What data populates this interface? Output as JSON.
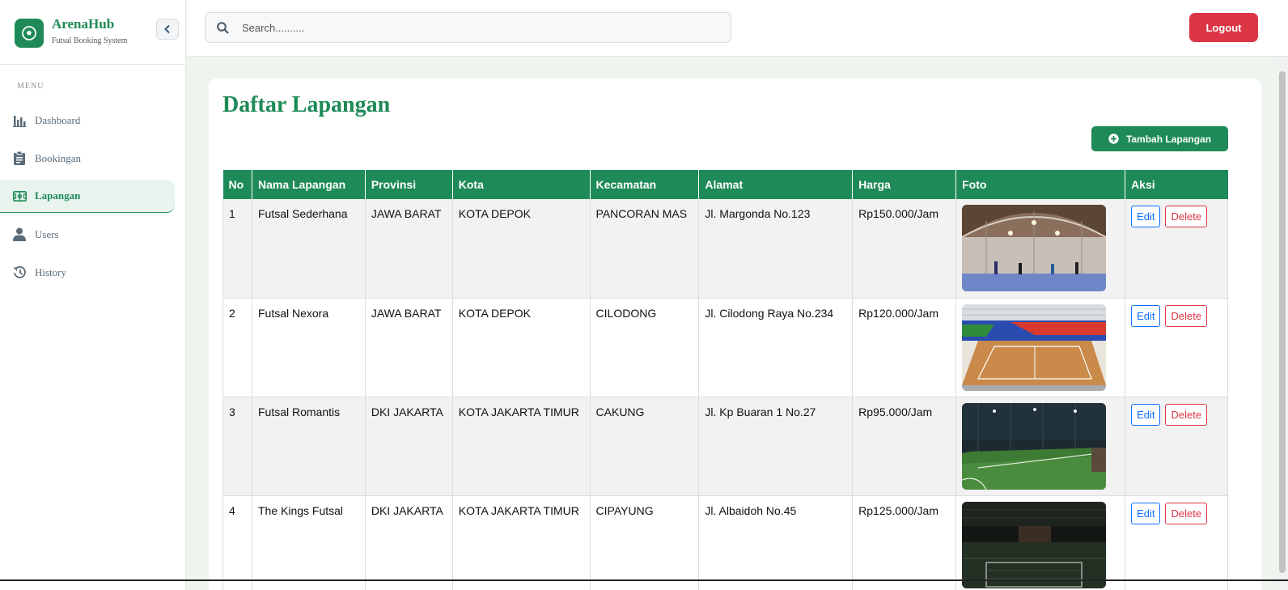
{
  "brand": {
    "name": "ArenaHub",
    "subtitle": "Futsal Booking System"
  },
  "sidebar": {
    "menu_label": "MENU",
    "items": [
      {
        "label": "Dashboard",
        "icon": "bar-chart-icon",
        "active": false
      },
      {
        "label": "Bookingan",
        "icon": "clipboard-icon",
        "active": false
      },
      {
        "label": "Lapangan",
        "icon": "field-icon",
        "active": true
      },
      {
        "label": "Users",
        "icon": "user-icon",
        "active": false
      },
      {
        "label": "History",
        "icon": "history-icon",
        "active": false
      }
    ]
  },
  "topbar": {
    "search_placeholder": "Search..........",
    "logout_label": "Logout"
  },
  "main": {
    "title": "Daftar Lapangan",
    "add_button_label": "Tambah Lapangan",
    "table": {
      "headers": [
        "No",
        "Nama Lapangan",
        "Provinsi",
        "Kota",
        "Kecamatan",
        "Alamat",
        "Harga",
        "Foto",
        "Aksi"
      ],
      "rows": [
        {
          "no": "1",
          "nama": "Futsal Sederhana",
          "provinsi": "JAWA BARAT",
          "kota": "KOTA DEPOK",
          "kecamatan": "PANCORAN MAS",
          "alamat": "Jl. Margonda No.123",
          "harga": "Rp150.000/Jam",
          "foto": "indoor-hall-photo"
        },
        {
          "no": "2",
          "nama": "Futsal Nexora",
          "provinsi": "JAWA BARAT",
          "kota": "KOTA DEPOK",
          "kecamatan": "CILODONG",
          "alamat": "Jl. Cilodong Raya No.234",
          "harga": "Rp120.000/Jam",
          "foto": "arena-photo"
        },
        {
          "no": "3",
          "nama": "Futsal Romantis",
          "provinsi": "DKI JAKARTA",
          "kota": "KOTA JAKARTA TIMUR",
          "kecamatan": "CAKUNG",
          "alamat": "Jl. Kp Buaran 1 No.27",
          "harga": "Rp95.000/Jam",
          "foto": "grass-field-photo"
        },
        {
          "no": "4",
          "nama": "The Kings Futsal",
          "provinsi": "DKI JAKARTA",
          "kota": "KOTA JAKARTA TIMUR",
          "kecamatan": "CIPAYUNG",
          "alamat": "Jl. Albaidoh No.45",
          "harga": "Rp125.000/Jam",
          "foto": "dark-field-photo"
        }
      ],
      "edit_label": "Edit",
      "delete_label": "Delete"
    }
  },
  "colors": {
    "primary": "#1e8a57",
    "danger": "#dc3545",
    "edit": "#0d6efd"
  }
}
